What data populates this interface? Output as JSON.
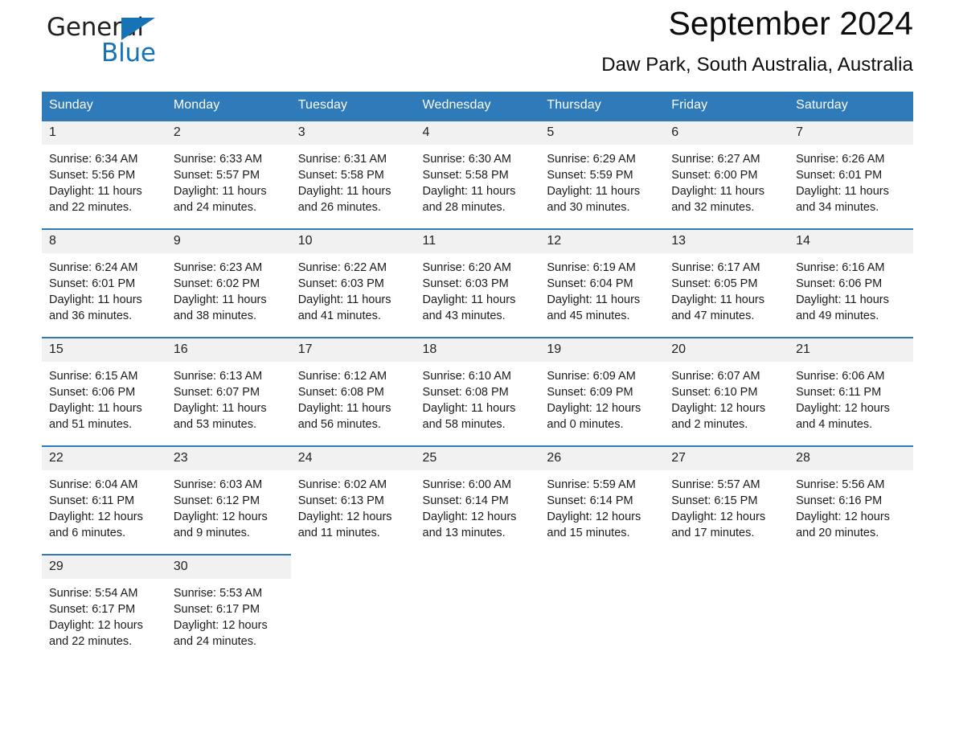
{
  "logo": {
    "word_one": "General",
    "word_two": "Blue",
    "triangle_color": "#1673b6",
    "text_color": "#231f20"
  },
  "header": {
    "title": "September 2024",
    "location": "Daw Park, South Australia, Australia"
  },
  "theme": {
    "header_bg": "#2f7ab8",
    "header_text": "#ffffff",
    "daynum_bg": "#f1f1f1",
    "row_rule": "#2f7ab8",
    "page_bg": "#ffffff"
  },
  "weekday_headers": [
    "Sunday",
    "Monday",
    "Tuesday",
    "Wednesday",
    "Thursday",
    "Friday",
    "Saturday"
  ],
  "weeks": [
    [
      {
        "day": "1",
        "sunrise": "Sunrise: 6:34 AM",
        "sunset": "Sunset: 5:56 PM",
        "daylight_line1": "Daylight: 11 hours",
        "daylight_line2": "and 22 minutes."
      },
      {
        "day": "2",
        "sunrise": "Sunrise: 6:33 AM",
        "sunset": "Sunset: 5:57 PM",
        "daylight_line1": "Daylight: 11 hours",
        "daylight_line2": "and 24 minutes."
      },
      {
        "day": "3",
        "sunrise": "Sunrise: 6:31 AM",
        "sunset": "Sunset: 5:58 PM",
        "daylight_line1": "Daylight: 11 hours",
        "daylight_line2": "and 26 minutes."
      },
      {
        "day": "4",
        "sunrise": "Sunrise: 6:30 AM",
        "sunset": "Sunset: 5:58 PM",
        "daylight_line1": "Daylight: 11 hours",
        "daylight_line2": "and 28 minutes."
      },
      {
        "day": "5",
        "sunrise": "Sunrise: 6:29 AM",
        "sunset": "Sunset: 5:59 PM",
        "daylight_line1": "Daylight: 11 hours",
        "daylight_line2": "and 30 minutes."
      },
      {
        "day": "6",
        "sunrise": "Sunrise: 6:27 AM",
        "sunset": "Sunset: 6:00 PM",
        "daylight_line1": "Daylight: 11 hours",
        "daylight_line2": "and 32 minutes."
      },
      {
        "day": "7",
        "sunrise": "Sunrise: 6:26 AM",
        "sunset": "Sunset: 6:01 PM",
        "daylight_line1": "Daylight: 11 hours",
        "daylight_line2": "and 34 minutes."
      }
    ],
    [
      {
        "day": "8",
        "sunrise": "Sunrise: 6:24 AM",
        "sunset": "Sunset: 6:01 PM",
        "daylight_line1": "Daylight: 11 hours",
        "daylight_line2": "and 36 minutes."
      },
      {
        "day": "9",
        "sunrise": "Sunrise: 6:23 AM",
        "sunset": "Sunset: 6:02 PM",
        "daylight_line1": "Daylight: 11 hours",
        "daylight_line2": "and 38 minutes."
      },
      {
        "day": "10",
        "sunrise": "Sunrise: 6:22 AM",
        "sunset": "Sunset: 6:03 PM",
        "daylight_line1": "Daylight: 11 hours",
        "daylight_line2": "and 41 minutes."
      },
      {
        "day": "11",
        "sunrise": "Sunrise: 6:20 AM",
        "sunset": "Sunset: 6:03 PM",
        "daylight_line1": "Daylight: 11 hours",
        "daylight_line2": "and 43 minutes."
      },
      {
        "day": "12",
        "sunrise": "Sunrise: 6:19 AM",
        "sunset": "Sunset: 6:04 PM",
        "daylight_line1": "Daylight: 11 hours",
        "daylight_line2": "and 45 minutes."
      },
      {
        "day": "13",
        "sunrise": "Sunrise: 6:17 AM",
        "sunset": "Sunset: 6:05 PM",
        "daylight_line1": "Daylight: 11 hours",
        "daylight_line2": "and 47 minutes."
      },
      {
        "day": "14",
        "sunrise": "Sunrise: 6:16 AM",
        "sunset": "Sunset: 6:06 PM",
        "daylight_line1": "Daylight: 11 hours",
        "daylight_line2": "and 49 minutes."
      }
    ],
    [
      {
        "day": "15",
        "sunrise": "Sunrise: 6:15 AM",
        "sunset": "Sunset: 6:06 PM",
        "daylight_line1": "Daylight: 11 hours",
        "daylight_line2": "and 51 minutes."
      },
      {
        "day": "16",
        "sunrise": "Sunrise: 6:13 AM",
        "sunset": "Sunset: 6:07 PM",
        "daylight_line1": "Daylight: 11 hours",
        "daylight_line2": "and 53 minutes."
      },
      {
        "day": "17",
        "sunrise": "Sunrise: 6:12 AM",
        "sunset": "Sunset: 6:08 PM",
        "daylight_line1": "Daylight: 11 hours",
        "daylight_line2": "and 56 minutes."
      },
      {
        "day": "18",
        "sunrise": "Sunrise: 6:10 AM",
        "sunset": "Sunset: 6:08 PM",
        "daylight_line1": "Daylight: 11 hours",
        "daylight_line2": "and 58 minutes."
      },
      {
        "day": "19",
        "sunrise": "Sunrise: 6:09 AM",
        "sunset": "Sunset: 6:09 PM",
        "daylight_line1": "Daylight: 12 hours",
        "daylight_line2": "and 0 minutes."
      },
      {
        "day": "20",
        "sunrise": "Sunrise: 6:07 AM",
        "sunset": "Sunset: 6:10 PM",
        "daylight_line1": "Daylight: 12 hours",
        "daylight_line2": "and 2 minutes."
      },
      {
        "day": "21",
        "sunrise": "Sunrise: 6:06 AM",
        "sunset": "Sunset: 6:11 PM",
        "daylight_line1": "Daylight: 12 hours",
        "daylight_line2": "and 4 minutes."
      }
    ],
    [
      {
        "day": "22",
        "sunrise": "Sunrise: 6:04 AM",
        "sunset": "Sunset: 6:11 PM",
        "daylight_line1": "Daylight: 12 hours",
        "daylight_line2": "and 6 minutes."
      },
      {
        "day": "23",
        "sunrise": "Sunrise: 6:03 AM",
        "sunset": "Sunset: 6:12 PM",
        "daylight_line1": "Daylight: 12 hours",
        "daylight_line2": "and 9 minutes."
      },
      {
        "day": "24",
        "sunrise": "Sunrise: 6:02 AM",
        "sunset": "Sunset: 6:13 PM",
        "daylight_line1": "Daylight: 12 hours",
        "daylight_line2": "and 11 minutes."
      },
      {
        "day": "25",
        "sunrise": "Sunrise: 6:00 AM",
        "sunset": "Sunset: 6:14 PM",
        "daylight_line1": "Daylight: 12 hours",
        "daylight_line2": "and 13 minutes."
      },
      {
        "day": "26",
        "sunrise": "Sunrise: 5:59 AM",
        "sunset": "Sunset: 6:14 PM",
        "daylight_line1": "Daylight: 12 hours",
        "daylight_line2": "and 15 minutes."
      },
      {
        "day": "27",
        "sunrise": "Sunrise: 5:57 AM",
        "sunset": "Sunset: 6:15 PM",
        "daylight_line1": "Daylight: 12 hours",
        "daylight_line2": "and 17 minutes."
      },
      {
        "day": "28",
        "sunrise": "Sunrise: 5:56 AM",
        "sunset": "Sunset: 6:16 PM",
        "daylight_line1": "Daylight: 12 hours",
        "daylight_line2": "and 20 minutes."
      }
    ],
    [
      {
        "day": "29",
        "sunrise": "Sunrise: 5:54 AM",
        "sunset": "Sunset: 6:17 PM",
        "daylight_line1": "Daylight: 12 hours",
        "daylight_line2": "and 22 minutes."
      },
      {
        "day": "30",
        "sunrise": "Sunrise: 5:53 AM",
        "sunset": "Sunset: 6:17 PM",
        "daylight_line1": "Daylight: 12 hours",
        "daylight_line2": "and 24 minutes."
      },
      {
        "day": "",
        "sunrise": "",
        "sunset": "",
        "daylight_line1": "",
        "daylight_line2": ""
      },
      {
        "day": "",
        "sunrise": "",
        "sunset": "",
        "daylight_line1": "",
        "daylight_line2": ""
      },
      {
        "day": "",
        "sunrise": "",
        "sunset": "",
        "daylight_line1": "",
        "daylight_line2": ""
      },
      {
        "day": "",
        "sunrise": "",
        "sunset": "",
        "daylight_line1": "",
        "daylight_line2": ""
      },
      {
        "day": "",
        "sunrise": "",
        "sunset": "",
        "daylight_line1": "",
        "daylight_line2": ""
      }
    ]
  ]
}
